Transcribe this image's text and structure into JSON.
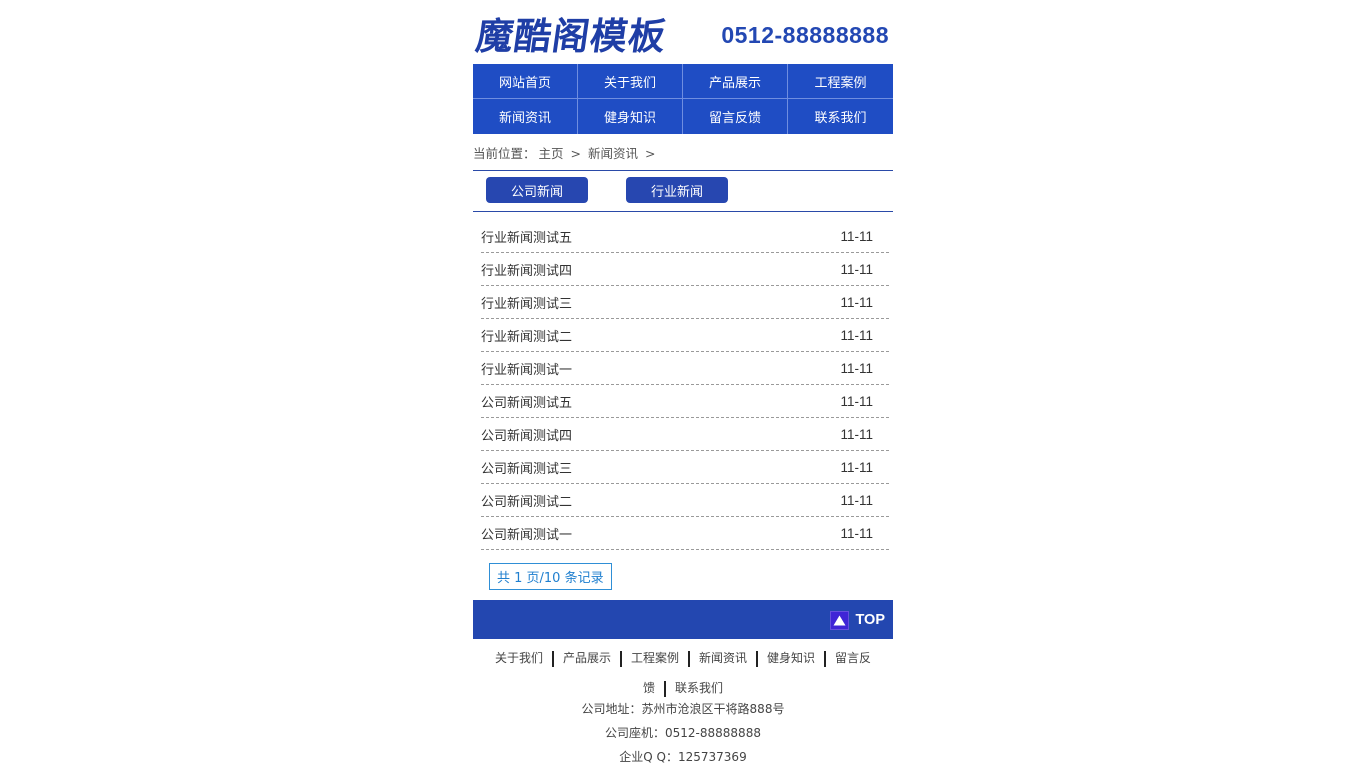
{
  "header": {
    "logo_text": "魔酷阁模板",
    "phone": "0512-88888888"
  },
  "nav": {
    "items": [
      {
        "label": "网站首页"
      },
      {
        "label": "关于我们"
      },
      {
        "label": "产品展示"
      },
      {
        "label": "工程案例"
      },
      {
        "label": "新闻资讯"
      },
      {
        "label": "健身知识"
      },
      {
        "label": "留言反馈"
      },
      {
        "label": "联系我们"
      }
    ]
  },
  "breadcrumb": {
    "prefix": "当前位置：",
    "home": "主页",
    "sep": ">",
    "current": "新闻资讯",
    "trail": ">"
  },
  "tabs": [
    {
      "label": "公司新闻"
    },
    {
      "label": "行业新闻"
    }
  ],
  "news": [
    {
      "title": "行业新闻测试五",
      "date": "11-11"
    },
    {
      "title": "行业新闻测试四",
      "date": "11-11"
    },
    {
      "title": "行业新闻测试三",
      "date": "11-11"
    },
    {
      "title": "行业新闻测试二",
      "date": "11-11"
    },
    {
      "title": "行业新闻测试一",
      "date": "11-11"
    },
    {
      "title": "公司新闻测试五",
      "date": "11-11"
    },
    {
      "title": "公司新闻测试四",
      "date": "11-11"
    },
    {
      "title": "公司新闻测试三",
      "date": "11-11"
    },
    {
      "title": "公司新闻测试二",
      "date": "11-11"
    },
    {
      "title": "公司新闻测试一",
      "date": "11-11"
    }
  ],
  "pagination": {
    "text": "共 1 页/10 条记录"
  },
  "footer": {
    "top_label": "TOP",
    "top_icon": "triangle-up-icon",
    "links_row1": [
      "关于我们",
      "产品展示",
      "工程案例",
      "新闻资讯",
      "健身知识",
      "留言反"
    ],
    "links_row2": [
      "馈",
      "联系我们"
    ],
    "address": "公司地址：苏州市沧浪区干将路888号",
    "tel": "公司座机：0512-88888888",
    "qq": "企业Q Q：125737369"
  },
  "colors": {
    "brand_blue": "#1e4cc2",
    "dark_blue": "#2347b0",
    "pager_blue": "#2f8fd6"
  }
}
